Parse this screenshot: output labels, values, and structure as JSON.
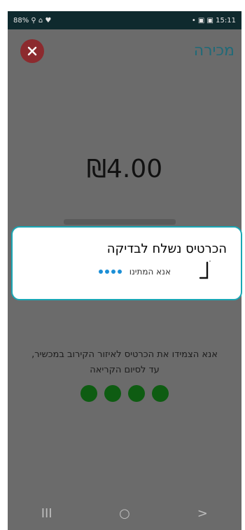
{
  "status_bar": {
    "left": "88% ⚲ ⌂ ♥",
    "right": "• ▣ ▣ 15:11"
  },
  "header": {
    "title": "מכירה"
  },
  "amount": "₪4.00",
  "instructions": {
    "line1": "אנא הצמידו את הכרטיס לאיזור הקירוב במכשיר,",
    "line2": "עד לסיום הקריאה"
  },
  "dialog": {
    "title": "הכרטיס נשלח לבדיקה",
    "subtitle": "אנא המתינו"
  },
  "nav": {
    "recents": "III",
    "home": "○",
    "back": ">"
  },
  "colors": {
    "accent": "#1aa7b5",
    "close_button": "#8c2a2e",
    "progress_dot": "#0e5c12",
    "loading_dot": "#1c8fd6"
  }
}
